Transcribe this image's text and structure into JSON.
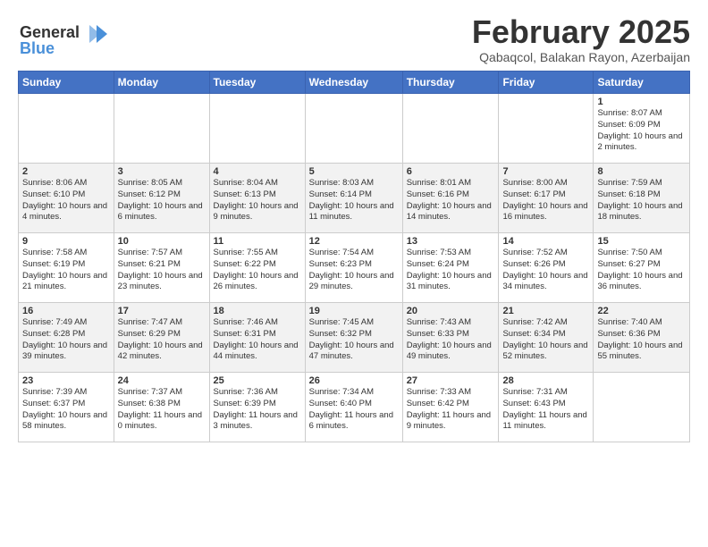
{
  "logo": {
    "text1": "General",
    "text2": "Blue"
  },
  "header": {
    "title": "February 2025",
    "subtitle": "Qabaqcol, Balakan Rayon, Azerbaijan"
  },
  "days": [
    "Sunday",
    "Monday",
    "Tuesday",
    "Wednesday",
    "Thursday",
    "Friday",
    "Saturday"
  ],
  "weeks": [
    [
      {
        "day": "",
        "info": ""
      },
      {
        "day": "",
        "info": ""
      },
      {
        "day": "",
        "info": ""
      },
      {
        "day": "",
        "info": ""
      },
      {
        "day": "",
        "info": ""
      },
      {
        "day": "",
        "info": ""
      },
      {
        "day": "1",
        "info": "Sunrise: 8:07 AM\nSunset: 6:09 PM\nDaylight: 10 hours and 2 minutes."
      }
    ],
    [
      {
        "day": "2",
        "info": "Sunrise: 8:06 AM\nSunset: 6:10 PM\nDaylight: 10 hours and 4 minutes."
      },
      {
        "day": "3",
        "info": "Sunrise: 8:05 AM\nSunset: 6:12 PM\nDaylight: 10 hours and 6 minutes."
      },
      {
        "day": "4",
        "info": "Sunrise: 8:04 AM\nSunset: 6:13 PM\nDaylight: 10 hours and 9 minutes."
      },
      {
        "day": "5",
        "info": "Sunrise: 8:03 AM\nSunset: 6:14 PM\nDaylight: 10 hours and 11 minutes."
      },
      {
        "day": "6",
        "info": "Sunrise: 8:01 AM\nSunset: 6:16 PM\nDaylight: 10 hours and 14 minutes."
      },
      {
        "day": "7",
        "info": "Sunrise: 8:00 AM\nSunset: 6:17 PM\nDaylight: 10 hours and 16 minutes."
      },
      {
        "day": "8",
        "info": "Sunrise: 7:59 AM\nSunset: 6:18 PM\nDaylight: 10 hours and 18 minutes."
      }
    ],
    [
      {
        "day": "9",
        "info": "Sunrise: 7:58 AM\nSunset: 6:19 PM\nDaylight: 10 hours and 21 minutes."
      },
      {
        "day": "10",
        "info": "Sunrise: 7:57 AM\nSunset: 6:21 PM\nDaylight: 10 hours and 23 minutes."
      },
      {
        "day": "11",
        "info": "Sunrise: 7:55 AM\nSunset: 6:22 PM\nDaylight: 10 hours and 26 minutes."
      },
      {
        "day": "12",
        "info": "Sunrise: 7:54 AM\nSunset: 6:23 PM\nDaylight: 10 hours and 29 minutes."
      },
      {
        "day": "13",
        "info": "Sunrise: 7:53 AM\nSunset: 6:24 PM\nDaylight: 10 hours and 31 minutes."
      },
      {
        "day": "14",
        "info": "Sunrise: 7:52 AM\nSunset: 6:26 PM\nDaylight: 10 hours and 34 minutes."
      },
      {
        "day": "15",
        "info": "Sunrise: 7:50 AM\nSunset: 6:27 PM\nDaylight: 10 hours and 36 minutes."
      }
    ],
    [
      {
        "day": "16",
        "info": "Sunrise: 7:49 AM\nSunset: 6:28 PM\nDaylight: 10 hours and 39 minutes."
      },
      {
        "day": "17",
        "info": "Sunrise: 7:47 AM\nSunset: 6:29 PM\nDaylight: 10 hours and 42 minutes."
      },
      {
        "day": "18",
        "info": "Sunrise: 7:46 AM\nSunset: 6:31 PM\nDaylight: 10 hours and 44 minutes."
      },
      {
        "day": "19",
        "info": "Sunrise: 7:45 AM\nSunset: 6:32 PM\nDaylight: 10 hours and 47 minutes."
      },
      {
        "day": "20",
        "info": "Sunrise: 7:43 AM\nSunset: 6:33 PM\nDaylight: 10 hours and 49 minutes."
      },
      {
        "day": "21",
        "info": "Sunrise: 7:42 AM\nSunset: 6:34 PM\nDaylight: 10 hours and 52 minutes."
      },
      {
        "day": "22",
        "info": "Sunrise: 7:40 AM\nSunset: 6:36 PM\nDaylight: 10 hours and 55 minutes."
      }
    ],
    [
      {
        "day": "23",
        "info": "Sunrise: 7:39 AM\nSunset: 6:37 PM\nDaylight: 10 hours and 58 minutes."
      },
      {
        "day": "24",
        "info": "Sunrise: 7:37 AM\nSunset: 6:38 PM\nDaylight: 11 hours and 0 minutes."
      },
      {
        "day": "25",
        "info": "Sunrise: 7:36 AM\nSunset: 6:39 PM\nDaylight: 11 hours and 3 minutes."
      },
      {
        "day": "26",
        "info": "Sunrise: 7:34 AM\nSunset: 6:40 PM\nDaylight: 11 hours and 6 minutes."
      },
      {
        "day": "27",
        "info": "Sunrise: 7:33 AM\nSunset: 6:42 PM\nDaylight: 11 hours and 9 minutes."
      },
      {
        "day": "28",
        "info": "Sunrise: 7:31 AM\nSunset: 6:43 PM\nDaylight: 11 hours and 11 minutes."
      },
      {
        "day": "",
        "info": ""
      }
    ]
  ]
}
